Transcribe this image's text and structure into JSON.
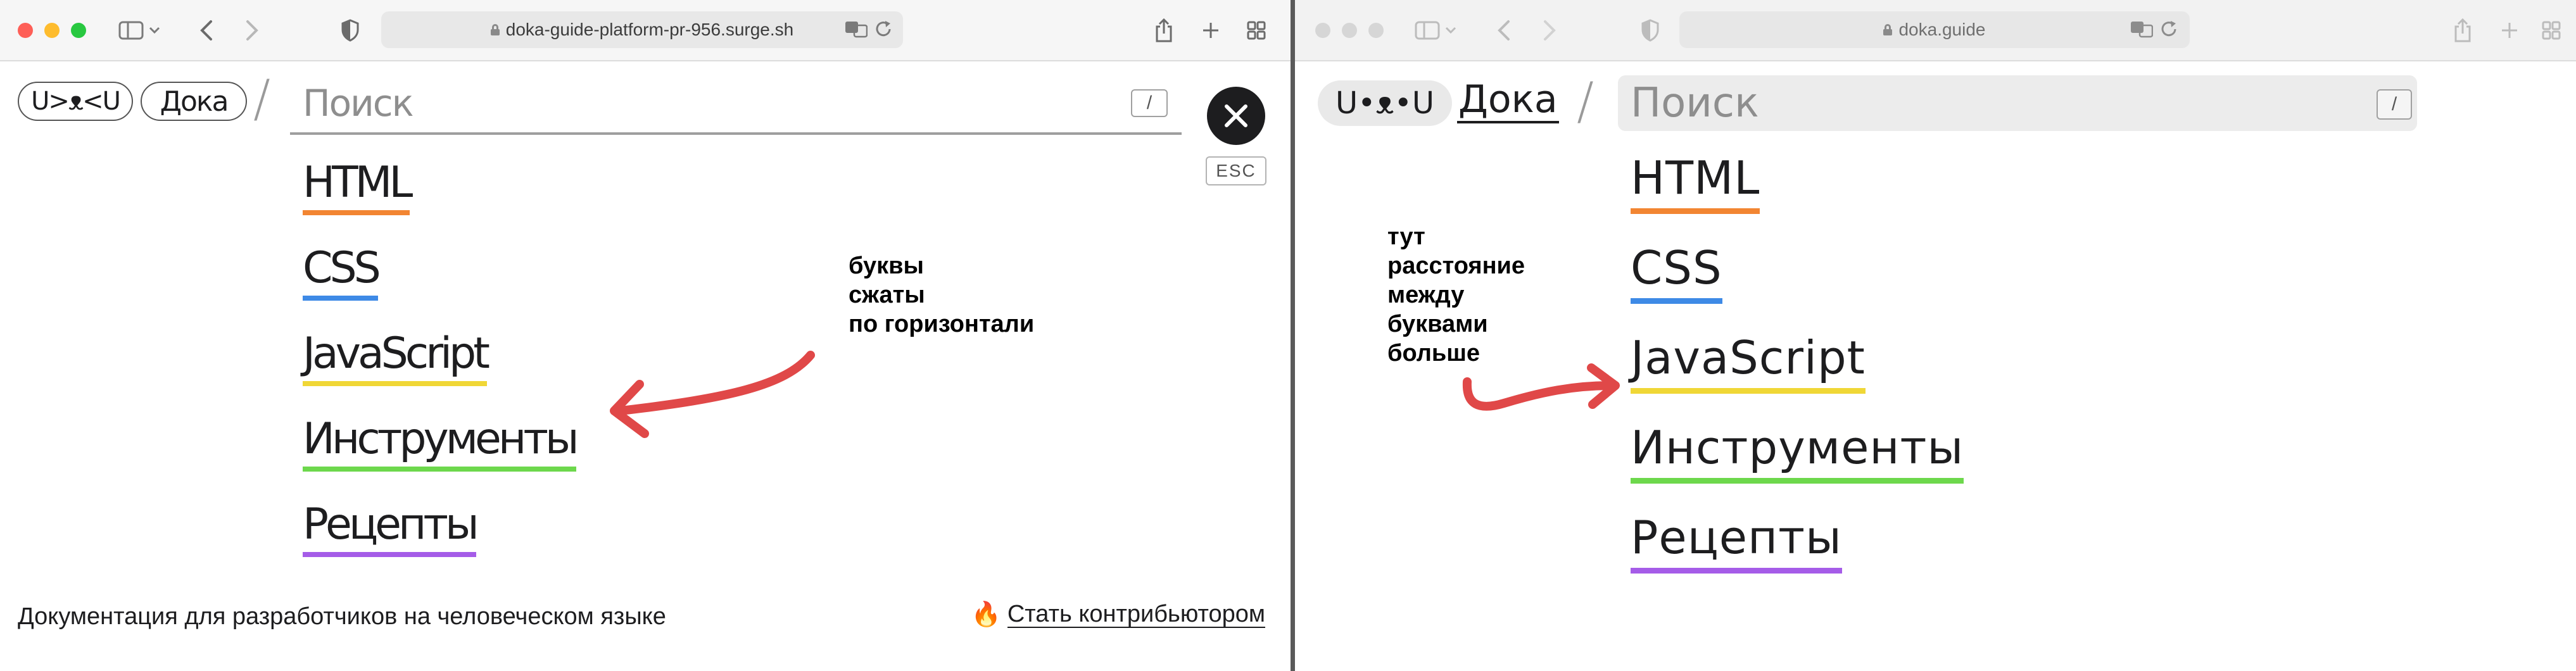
{
  "left_window": {
    "url": "doka-guide-platform-pr-956.surge.sh",
    "logo_text": "U>ᴥ<U",
    "doka_label": "Дока",
    "search_placeholder": "Поиск",
    "slash_key": "/",
    "esc_label": "ESC",
    "nav_items": [
      {
        "label": "HTML",
        "color": "#f28532"
      },
      {
        "label": "CSS",
        "color": "#3e8ae6"
      },
      {
        "label": "JavaScript",
        "color": "#f0d736"
      },
      {
        "label": "Инструменты",
        "color": "#6dd84c"
      },
      {
        "label": "Рецепты",
        "color": "#a55ce8"
      }
    ],
    "annotation_lines": [
      "буквы",
      "сжаты",
      "по горизонтали"
    ],
    "footer_text": "Документация для разработчиков на человеческом языке",
    "footer_link_icon": "🔥",
    "footer_link_text": "Стать контрибьютором"
  },
  "right_window": {
    "url": "doka.guide",
    "logo_text": "U•ᴥ•U",
    "doka_label": "Дока",
    "search_placeholder": "Поиск",
    "slash_key": "/",
    "nav_items": [
      {
        "label": "HTML",
        "color": "#f28532"
      },
      {
        "label": "CSS",
        "color": "#3e8ae6"
      },
      {
        "label": "JavaScript",
        "color": "#f0d736"
      },
      {
        "label": "Инструменты",
        "color": "#6dd84c"
      },
      {
        "label": "Рецепты",
        "color": "#a55ce8"
      }
    ],
    "annotation_lines": [
      "тут",
      "расстояние",
      "между",
      "буквами",
      "больше"
    ]
  },
  "colors": {
    "annotation_arrow": "#e04848"
  }
}
